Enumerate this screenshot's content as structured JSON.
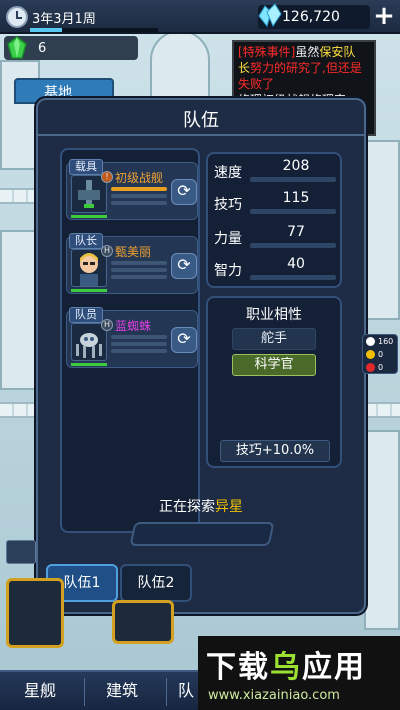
{
  "topbar": {
    "date": "3年3月1周",
    "date_progress": 0.25,
    "money": "126,720",
    "gems": "6"
  },
  "base_tab": "基地",
  "event": {
    "line1_red": "[特殊事件]",
    "line1_rest": "虽然",
    "line1_yellow": "保安队",
    "line2_yellow": "长",
    "line2_red": "努力的研究了,但还是",
    "line3": "失败了",
    "line4": "修理初级战舰修理完"
  },
  "panel": {
    "title": "队伍",
    "slots": [
      {
        "tag": "载具",
        "name": "初级战舰",
        "name_color": "#f0a030",
        "badge": "!"
      },
      {
        "tag": "队长",
        "name": "甄美丽",
        "name_color": "#f0a030",
        "badge": "H"
      },
      {
        "tag": "队员",
        "name": "蓝蜘蛛",
        "name_color": "#e040e0",
        "badge": "H"
      }
    ],
    "stats": [
      {
        "label": "速度",
        "value": "208"
      },
      {
        "label": "技巧",
        "value": "115"
      },
      {
        "label": "力量",
        "value": "77"
      },
      {
        "label": "智力",
        "value": "40"
      }
    ],
    "career": {
      "title": "职业相性",
      "tags": [
        "舵手",
        "科学官"
      ],
      "bonus": "技巧+10.0%"
    },
    "explore_prefix": "正在探索",
    "explore_target": "异星",
    "teams": [
      "队伍1",
      "队伍2"
    ]
  },
  "side_indicators": [
    "160",
    "0",
    "0"
  ],
  "bottom_nav": [
    "星舰",
    "建筑",
    "队"
  ],
  "watermark": {
    "title_a": "下载",
    "title_b": "乌",
    "title_c": "应用",
    "url": "www.xiazainiao.com"
  },
  "colors": {
    "accent": "#4fa0e0",
    "panel": "#1d2b44",
    "highlight": "#f0c000"
  }
}
